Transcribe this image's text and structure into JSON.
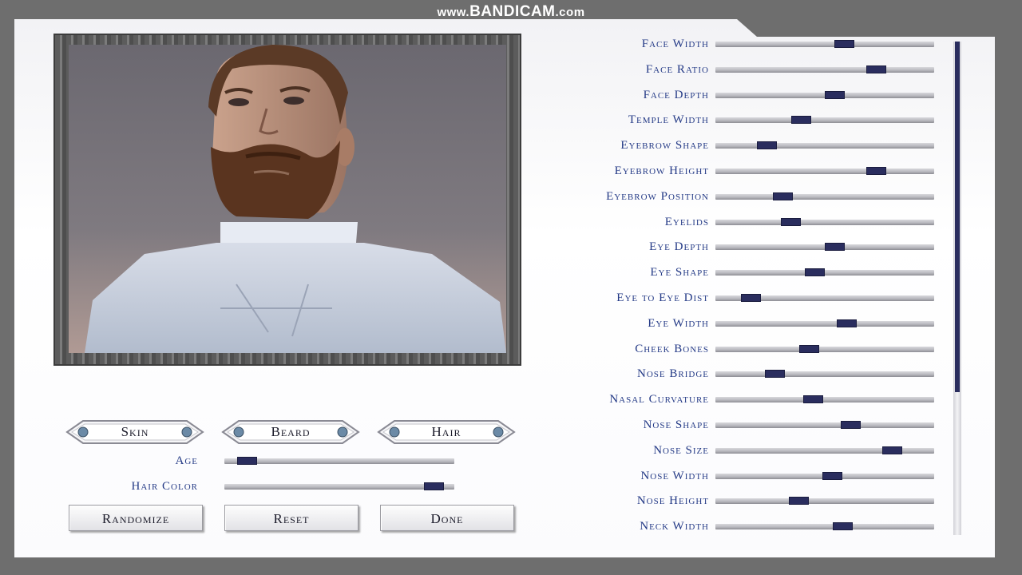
{
  "watermark": {
    "prefix": "www.",
    "brand": "BANDICAM",
    "suffix": ".com"
  },
  "tabs": [
    {
      "label": "Skin"
    },
    {
      "label": "Beard"
    },
    {
      "label": "Hair"
    }
  ],
  "basic_sliders": [
    {
      "label": "Age",
      "value": 0.06
    },
    {
      "label": "Hair Color",
      "value": 0.95
    }
  ],
  "buttons": {
    "randomize": "Randomize",
    "reset": "Reset",
    "done": "Done"
  },
  "face_sliders": [
    {
      "label": "Face Width",
      "value": 0.6
    },
    {
      "label": "Face Ratio",
      "value": 0.76
    },
    {
      "label": "Face Depth",
      "value": 0.55
    },
    {
      "label": "Temple Width",
      "value": 0.38
    },
    {
      "label": "Eyebrow Shape",
      "value": 0.21
    },
    {
      "label": "Eyebrow Height",
      "value": 0.76
    },
    {
      "label": "Eyebrow Position",
      "value": 0.29
    },
    {
      "label": "Eyelids",
      "value": 0.33
    },
    {
      "label": "Eye Depth",
      "value": 0.55
    },
    {
      "label": "Eye Shape",
      "value": 0.45
    },
    {
      "label": "Eye to Eye Dist",
      "value": 0.13
    },
    {
      "label": "Eye Width",
      "value": 0.61
    },
    {
      "label": "Cheek Bones",
      "value": 0.42
    },
    {
      "label": "Nose Bridge",
      "value": 0.25
    },
    {
      "label": "Nasal Curvature",
      "value": 0.44
    },
    {
      "label": "Nose Shape",
      "value": 0.63
    },
    {
      "label": "Nose Size",
      "value": 0.84
    },
    {
      "label": "Nose Width",
      "value": 0.54
    },
    {
      "label": "Nose Height",
      "value": 0.37
    },
    {
      "label": "Neck Width",
      "value": 0.59
    }
  ],
  "scrollbar": {
    "position": 0.0,
    "visible_fraction": 0.71
  },
  "colors": {
    "label": "#243a86",
    "thumb": "#2a2d5e"
  },
  "icons": {
    "tab_gem": "orb-icon",
    "tab_arrow": "chevron-icon"
  }
}
